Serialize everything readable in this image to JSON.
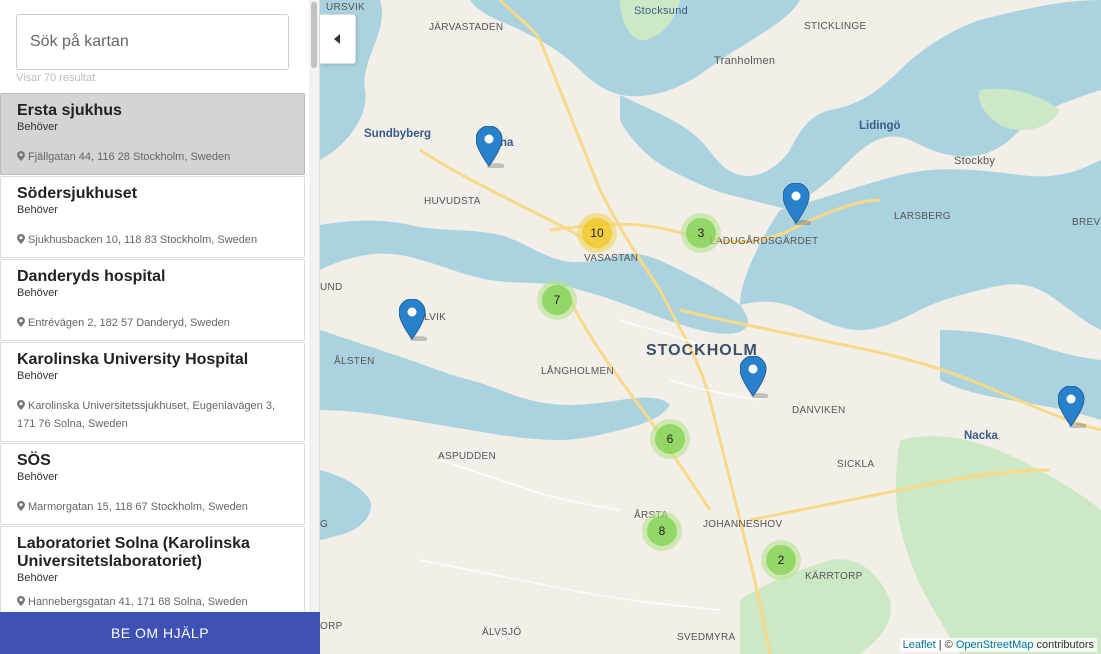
{
  "search": {
    "placeholder": "Sök på kartan",
    "value": "",
    "result_count": "Visar 70 resultat"
  },
  "results": [
    {
      "name": "Ersta sjukhus",
      "status": "Behöver",
      "address": "Fjällgatan 44, 116 28 Stockholm, Sweden"
    },
    {
      "name": "Södersjukhuset",
      "status": "Behöver",
      "address": "Sjukhusbacken 10, 118 83 Stockholm, Sweden"
    },
    {
      "name": "Danderyds hospital",
      "status": "Behöver",
      "address": "Entrévägen 2, 182 57 Danderyd, Sweden"
    },
    {
      "name": "Karolinska University Hospital",
      "status": "Behöver",
      "address": "Karolinska Universitetssjukhuset, Eugeniavägen 3, 171 76 Solna, Sweden"
    },
    {
      "name": "SÖS",
      "status": "Behöver",
      "address": "Marmorgatan 15, 118 67 Stockholm, Sweden"
    },
    {
      "name": "Laboratoriet Solna (Karolinska Universitetslaboratoriet)",
      "status": "Behöver",
      "address": "Hannebergsgatan 41, 171 68 Solna, Sweden"
    }
  ],
  "help_button": "BE OM HJÄLP",
  "map": {
    "places": {
      "ursvik": "URSVIK",
      "jarvastaden": "JÄRVASTADEN",
      "stocksund": "Stocksund",
      "sticklinge": "STICKLINGE",
      "tranholmen": "Tranholmen",
      "sundbyberg": "Sundbyberg",
      "solna": "na",
      "lidingo": "Lidingö",
      "stockby": "Stockby",
      "huvudsta": "HUVUDSTA",
      "larsberg": "LARSBERG",
      "brevik": "BREVI",
      "ladugardsgardet": "LADUGÅRDSGÄRDET",
      "vasastan": "VASASTAN",
      "und": "UND",
      "alvik": "LVIK",
      "alsten": "ÅLSTEN",
      "langholmen": "LÅNGHOLMEN",
      "stockholm": "STOCKHOLM",
      "danviken": "DANVIKEN",
      "nacka": "Nacka",
      "aspudden": "ASPUDDEN",
      "sickla": "SICKLA",
      "arsta": "ÅRSTA",
      "johanneshov": "JOHANNESHOV",
      "karrtorp": "KÄRRTORP",
      "orp": "ORP",
      "alvsjo": "ÄLVSJÖ",
      "svedmyra": "SVEDMYRA",
      "g": "G"
    },
    "clusters": [
      {
        "count": "10",
        "level": "yellow"
      },
      {
        "count": "3",
        "level": "green"
      },
      {
        "count": "7",
        "level": "green"
      },
      {
        "count": "6",
        "level": "green"
      },
      {
        "count": "8",
        "level": "green"
      },
      {
        "count": "2",
        "level": "green"
      }
    ],
    "attribution": {
      "leaflet": "Leaflet",
      "separator": " | © ",
      "osm": "OpenStreetMap",
      "suffix": " contributors"
    }
  },
  "colors": {
    "accent": "#3f51b5",
    "water": "#aad3df",
    "land": "#f2efe9",
    "marker": "#2a81cb"
  }
}
